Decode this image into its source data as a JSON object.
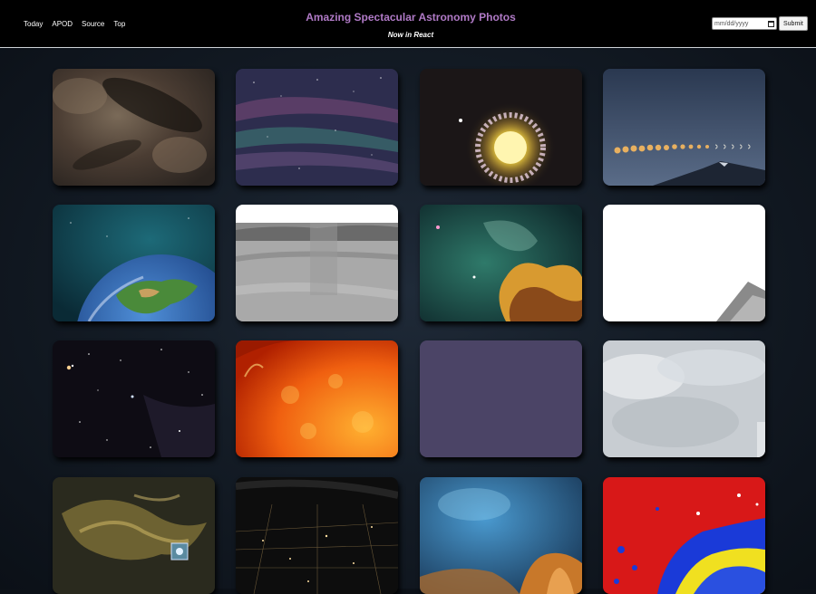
{
  "nav": {
    "items": [
      {
        "label": "Today"
      },
      {
        "label": "APOD"
      },
      {
        "label": "Source"
      },
      {
        "label": "Top"
      }
    ]
  },
  "header": {
    "title": "Amazing Spectacular Astronomy Photos",
    "subtitle": "Now in React"
  },
  "date_form": {
    "placeholder": "mm/dd/yyyy",
    "submit_label": "Submit"
  },
  "gallery": {
    "photos": [
      {
        "name": "dark-nebula-photo"
      },
      {
        "name": "milky-way-airglow-photo"
      },
      {
        "name": "ring-galaxy-photo"
      },
      {
        "name": "moon-phases-sequence-photo"
      },
      {
        "name": "earth-from-space-photo"
      },
      {
        "name": "planet-surface-panorama-photo"
      },
      {
        "name": "colorful-nebula-photo"
      },
      {
        "name": "blank-white-photo"
      },
      {
        "name": "star-field-photo"
      },
      {
        "name": "sun-surface-photo"
      },
      {
        "name": "purple-placeholder-photo"
      },
      {
        "name": "cloudy-sky-photo"
      },
      {
        "name": "planetary-nebula-photo"
      },
      {
        "name": "city-lights-from-orbit-photo"
      },
      {
        "name": "blue-orange-nebula-photo"
      },
      {
        "name": "false-color-map-photo"
      }
    ]
  }
}
